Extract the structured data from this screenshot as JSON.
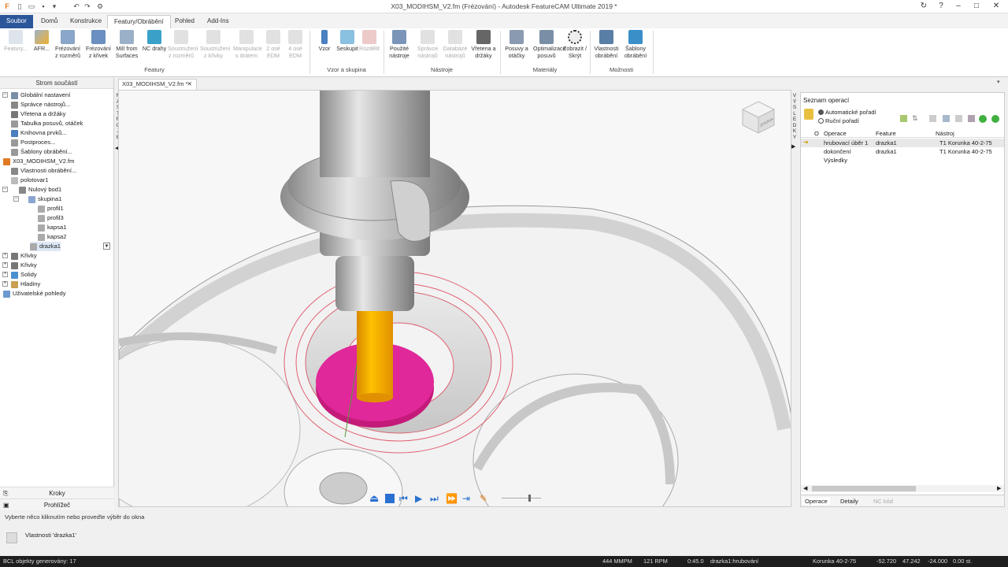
{
  "window": {
    "title": "X03_MODIHSM_V2.fm (Frézování) - Autodesk FeatureCAM Ultimate 2019 *"
  },
  "tabs": [
    {
      "label": "Soubor"
    },
    {
      "label": "Domů"
    },
    {
      "label": "Konstrukce"
    },
    {
      "label": "Featury/Obrábění"
    },
    {
      "label": "Pohled"
    },
    {
      "label": "Add-Ins"
    }
  ],
  "ribbon": {
    "featury_group": "Featury",
    "vzor_group": "Vzor a skupina",
    "nastroje_group": "Nástroje",
    "materialy_group": "Materiály",
    "moznosti_group": "Možnosti",
    "buttons": [
      {
        "label": "Featury...",
        "disabled": true
      },
      {
        "label": "AFR...",
        "disabled": false
      },
      {
        "label": "Frézování z rozměrů",
        "disabled": false
      },
      {
        "label": "Frézování z křivek",
        "disabled": false
      },
      {
        "label": "Mill from Surfaces",
        "disabled": false
      },
      {
        "label": "NC drahy",
        "disabled": false
      },
      {
        "label": "Soustružení z rozměrů",
        "disabled": true
      },
      {
        "label": "Soustružení z křivky",
        "disabled": true
      },
      {
        "label": "Manipulace s drátem",
        "disabled": true
      },
      {
        "label": "2 osé EDM",
        "disabled": true
      },
      {
        "label": "4 osé EDM",
        "disabled": true
      },
      {
        "label": "Vzor",
        "disabled": false
      },
      {
        "label": "Seskupit",
        "disabled": false
      },
      {
        "label": "Rozdělit",
        "disabled": true
      },
      {
        "label": "Použité nástroje",
        "disabled": false
      },
      {
        "label": "Správce nástrojů",
        "disabled": true
      },
      {
        "label": "Databáze nástrojů",
        "disabled": true
      },
      {
        "label": "Vřetena a držáky",
        "disabled": false
      },
      {
        "label": "Posuvy a otáčky",
        "disabled": false
      },
      {
        "label": "Optimalizace posuvů",
        "disabled": false
      },
      {
        "label": "Zobrazit / Skrýt",
        "disabled": false
      },
      {
        "label": "Vlastnosti obrábění",
        "disabled": false
      },
      {
        "label": "Šablony obrábění",
        "disabled": false
      }
    ]
  },
  "left_panel": {
    "header": "Strom součástí",
    "items": [
      {
        "label": "Globální nastavení",
        "color": "#7a8fa6"
      },
      {
        "label": "Správce nástrojů...",
        "color": "#888"
      },
      {
        "label": "Vřetena a držáky",
        "color": "#777"
      },
      {
        "label": "Tabulka posuvů, otáček",
        "color": "#999"
      },
      {
        "label": "Knihovna prvků...",
        "color": "#4a7fc0"
      },
      {
        "label": "Postproces...",
        "color": "#999"
      },
      {
        "label": "Šablony obrábění...",
        "color": "#999"
      },
      {
        "label": "X03_MODIHSM_V2.fm",
        "color": "#e07b22"
      },
      {
        "label": "Vlastnosti obrábění...",
        "color": "#888"
      },
      {
        "label": "polotovar1",
        "color": "#bbb"
      },
      {
        "label": "Nulový bod1",
        "color": "#888"
      },
      {
        "label": "skupina1",
        "color": "#8aa6d0"
      },
      {
        "label": "profil1",
        "color": "#aaa"
      },
      {
        "label": "profil3",
        "color": "#aaa"
      },
      {
        "label": "kapsa1",
        "color": "#aaa"
      },
      {
        "label": "kapsa2",
        "color": "#aaa"
      },
      {
        "label": "drazka1",
        "color": "#aaa"
      },
      {
        "label": "Křivky",
        "color": "#777"
      },
      {
        "label": "Křivky",
        "color": "#777"
      },
      {
        "label": "Solidy",
        "color": "#4a90d0"
      },
      {
        "label": "Hladiny",
        "color": "#c8a050"
      },
      {
        "label": "Uživatelské pohledy",
        "color": "#6a9ad0"
      }
    ],
    "footer_steps": "Kroky",
    "footer_browser": "Prohlížeč"
  },
  "side_tabs": {
    "left": "NÁSTROJE",
    "right": "VÝSLEDKY"
  },
  "viewport": {
    "doc_tab": "X03_MODIHSM_V2.fm *",
    "viewcube": "ZPRAVA"
  },
  "right_panel": {
    "title": "Seznam operací",
    "auto_order": "Automatické pořadí",
    "manual_order": "Ruční pořadí",
    "col_o": "O",
    "col_op": "Operace",
    "col_feature": "Feature",
    "col_tool": "Nástroj",
    "rows": [
      {
        "op": "hrubovací úběr 1",
        "feature": "drazka1",
        "tool": "T1 Korunka 40-2-75"
      },
      {
        "op": "dokončení",
        "feature": "drazka1",
        "tool": "T1 Korunka 40-2-75"
      }
    ],
    "results": "Výsledky",
    "bottom_tabs": [
      "Operace",
      "Detaily",
      "NC kód"
    ]
  },
  "status": {
    "hint": "Vyberte něco kliknutím nebo proveďte výběr do okna",
    "properties": "Vlastnosti 'drazka1'",
    "bcl": "BCL objekty generovány: 17",
    "mmpm": "444 MMPM",
    "rpm": "121 RPM",
    "time": "0:45.0",
    "op": "drazka1:hrubování",
    "tool": "Korunka 40-2-75",
    "x": "-52.720",
    "y": "47.242",
    "z": "-24.000",
    "angle": "0.00 st."
  },
  "colors": {
    "file_tab": "#2b579a",
    "tool": "#f4a300",
    "part": "#e0289a"
  }
}
